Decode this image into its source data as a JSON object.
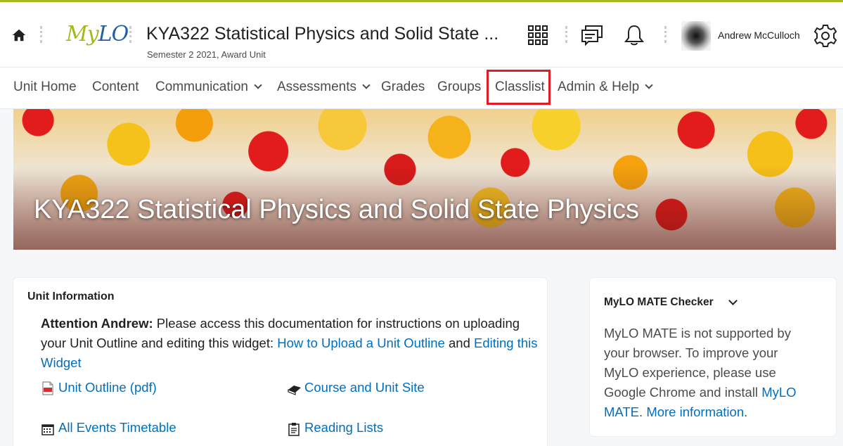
{
  "header": {
    "logo_my": "My",
    "logo_lo": "LO",
    "course_title": "KYA322 Statistical Physics and Solid State ...",
    "course_subtitle": "Semester 2 2021, Award Unit",
    "user_name": "Andrew McCulloch"
  },
  "nav": {
    "items": [
      {
        "label": "Unit Home"
      },
      {
        "label": "Content"
      },
      {
        "label": "Communication",
        "dropdown": true
      },
      {
        "label": "Assessments",
        "dropdown": true
      },
      {
        "label": "Grades"
      },
      {
        "label": "Groups"
      },
      {
        "label": "Classlist",
        "highlighted": true
      },
      {
        "label": "Admin & Help",
        "dropdown": true
      }
    ]
  },
  "banner": {
    "title": "KYA322 Statistical Physics and Solid State Physics"
  },
  "unit_info": {
    "heading": "Unit Information",
    "attention_prefix": "Attention Andrew:",
    "attention_text_1": " Please access this documentation for instructions on uploading your Unit Outline and editing this widget: ",
    "link_upload": "How to Upload a Unit Outline",
    "and_text": " and ",
    "link_editing": "Editing this Widget",
    "resources": [
      {
        "label": "Unit Outline (pdf)",
        "icon": "pdf-icon"
      },
      {
        "label": "Course and Unit Site",
        "icon": "book-icon"
      },
      {
        "label": "All Events Timetable",
        "icon": "calendar-icon"
      },
      {
        "label": "Reading Lists",
        "icon": "clipboard-icon"
      }
    ]
  },
  "mate_checker": {
    "heading": "MyLO MATE Checker",
    "text": "MyLO MATE is not supported by your browser. To improve your MyLO experience, please use Google Chrome and install ",
    "link_mate": "MyLO MATE",
    "text_2": ". ",
    "link_more": "More information",
    "text_3": "."
  },
  "colors": {
    "accent": "#a5b81e",
    "link": "#006fbf",
    "highlight": "#e01b22"
  }
}
